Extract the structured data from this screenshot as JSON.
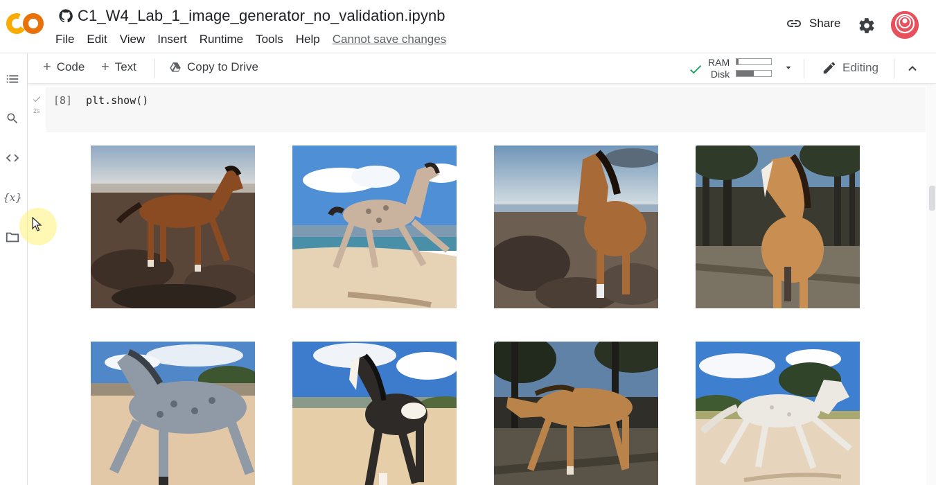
{
  "header": {
    "notebook_title": "C1_W4_Lab_1_image_generator_no_validation.ipynb",
    "logo_text": "CO",
    "menu": [
      "File",
      "Edit",
      "View",
      "Insert",
      "Runtime",
      "Tools",
      "Help"
    ],
    "save_status": "Cannot save changes",
    "share_label": "Share",
    "icons": {
      "github": "github-icon",
      "share": "link-icon",
      "settings": "gear-icon",
      "avatar": "user-avatar"
    }
  },
  "siderail": {
    "items": [
      {
        "name": "table-of-contents-icon"
      },
      {
        "name": "search-icon"
      },
      {
        "name": "code-snippets-icon"
      },
      {
        "name": "variables-icon",
        "glyph": "{x}"
      },
      {
        "name": "files-folder-icon"
      }
    ]
  },
  "toolbar": {
    "code_label": "Code",
    "text_label": "Text",
    "copy_to_drive_label": "Copy to Drive",
    "ram_label": "RAM",
    "disk_label": "Disk",
    "ram_usage": 0.06,
    "disk_usage": 0.5,
    "editing_label": "Editing"
  },
  "cell": {
    "exec_count": "[8]",
    "run_time": "2s",
    "code": "plt.show()"
  },
  "output": {
    "images": [
      {
        "name": "horse-image-1",
        "coat": "chestnut",
        "scene": "rocky-shore"
      },
      {
        "name": "horse-image-2",
        "coat": "dappled-grey",
        "scene": "beach"
      },
      {
        "name": "horse-image-3",
        "coat": "bay",
        "scene": "rocky-shore"
      },
      {
        "name": "horse-image-4",
        "coat": "palomino",
        "scene": "forest"
      },
      {
        "name": "horse-image-5",
        "coat": "dapple-grey",
        "scene": "desert-sand"
      },
      {
        "name": "horse-image-6",
        "coat": "black-white-pinto",
        "scene": "beach"
      },
      {
        "name": "horse-image-7",
        "coat": "buckskin",
        "scene": "forest"
      },
      {
        "name": "horse-image-8",
        "coat": "white",
        "scene": "desert-sand"
      }
    ]
  },
  "colors": {
    "logo_orange": "#f9ab00",
    "logo_dark_orange": "#e8710a",
    "avatar_red": "#e8505b",
    "check_green": "#0f9d58",
    "code_bg": "#f7f7f7"
  }
}
